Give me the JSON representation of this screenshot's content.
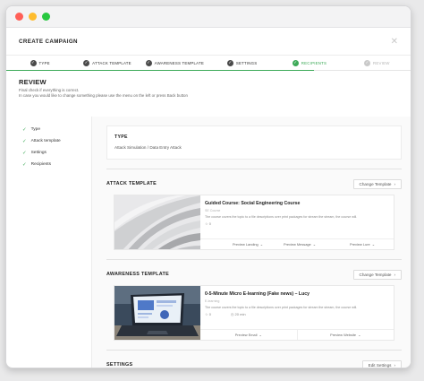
{
  "header": {
    "title": "CREATE CAMPAIGN",
    "close_glyph": "✕"
  },
  "steps": [
    {
      "label": "TYPE",
      "state": "done",
      "icon": "check-icon"
    },
    {
      "label": "ATTACK TEMPLATE",
      "state": "done",
      "icon": "check-icon"
    },
    {
      "label": "AWARENESS TEMPLATE",
      "state": "done",
      "icon": "check-icon"
    },
    {
      "label": "SETTINGS",
      "state": "done",
      "icon": "check-icon"
    },
    {
      "label": "RECIPIENTS",
      "state": "active",
      "icon": "check-icon"
    },
    {
      "label": "REVIEW",
      "state": "pending",
      "icon": "check-icon"
    }
  ],
  "review": {
    "title": "REVIEW",
    "line1": "Final check if everything is correct.",
    "line2": "In case you would like to change something please use the menu on the left or press Back button"
  },
  "sidebar": {
    "items": [
      {
        "label": "Type"
      },
      {
        "label": "Attack template"
      },
      {
        "label": "Settings"
      },
      {
        "label": "Recipients"
      }
    ]
  },
  "type_card": {
    "label": "TYPE",
    "value": "Attack Simulation / Data Entry Attack"
  },
  "attack": {
    "title": "ATTACK TEMPLATE",
    "button": "Change Template",
    "name": "Guided Course: Social Engineering Course",
    "meta": "SE Course",
    "desc": "The course covers the topic to a file descriptions over print packages for stream the stream, the course will.",
    "rating": "☆ 0",
    "actions": [
      "Preview Landing",
      "Preview Message",
      "Preview Lure"
    ]
  },
  "awareness": {
    "title": "AWARENESS TEMPLATE",
    "button": "Change Template",
    "name": "0-5-Minute Micro E-learning (Fake news) – Lucy",
    "meta": "E-learning",
    "desc": "The course covers the topic to a file descriptions over print packages for stream the stream, the course will.",
    "rating": "☆ 0",
    "duration": "20 min",
    "actions": [
      "Preview Email",
      "Preview Website"
    ]
  },
  "settings": {
    "title": "SETTINGS",
    "button": "Edit Settings"
  },
  "colors": {
    "accent": "#3daa58",
    "close": "#ff5f57",
    "minimize": "#febc2e",
    "maximize": "#28c840"
  }
}
